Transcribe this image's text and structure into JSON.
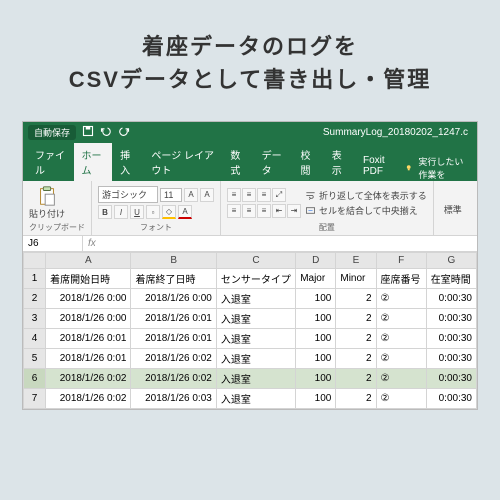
{
  "heading_line1": "着座データのログを",
  "heading_line2": "CSVデータとして書き出し・管理",
  "titlebar": {
    "autosave": "自動保存",
    "filename": "SummaryLog_20180202_1247.c"
  },
  "tabs": [
    "ファイル",
    "ホーム",
    "挿入",
    "ページ レイアウト",
    "数式",
    "データ",
    "校閲",
    "表示",
    "Foxit PDF"
  ],
  "tell_me": "実行したい作業を",
  "ribbon": {
    "paste": "貼り付け",
    "clipboard_label": "クリップボード",
    "font_name": "游ゴシック",
    "font_size": "11",
    "font_label": "フォント",
    "align_label": "配置",
    "wrap_text": "折り返して全体を表示する",
    "merge_center": "セルを結合して中央揃え",
    "num_label": "標準"
  },
  "name_box": "J6",
  "fx": "fx",
  "columns": [
    "A",
    "B",
    "C",
    "D",
    "E",
    "F",
    "G"
  ],
  "headers": [
    "着席開始日時",
    "着席終了日時",
    "センサータイプ",
    "Major",
    "Minor",
    "座席番号",
    "在室時間"
  ],
  "rows": [
    {
      "n": "2",
      "a": "2018/1/26 0:00",
      "b": "2018/1/26 0:00",
      "c": "入退室",
      "d": "100",
      "e": "2",
      "f": "②",
      "g": "0:00:30"
    },
    {
      "n": "3",
      "a": "2018/1/26 0:00",
      "b": "2018/1/26 0:01",
      "c": "入退室",
      "d": "100",
      "e": "2",
      "f": "②",
      "g": "0:00:30"
    },
    {
      "n": "4",
      "a": "2018/1/26 0:01",
      "b": "2018/1/26 0:01",
      "c": "入退室",
      "d": "100",
      "e": "2",
      "f": "②",
      "g": "0:00:30"
    },
    {
      "n": "5",
      "a": "2018/1/26 0:01",
      "b": "2018/1/26 0:02",
      "c": "入退室",
      "d": "100",
      "e": "2",
      "f": "②",
      "g": "0:00:30"
    },
    {
      "n": "6",
      "a": "2018/1/26 0:02",
      "b": "2018/1/26 0:02",
      "c": "入退室",
      "d": "100",
      "e": "2",
      "f": "②",
      "g": "0:00:30",
      "sel": true
    },
    {
      "n": "7",
      "a": "2018/1/26 0:02",
      "b": "2018/1/26 0:03",
      "c": "入退室",
      "d": "100",
      "e": "2",
      "f": "②",
      "g": "0:00:30"
    }
  ]
}
